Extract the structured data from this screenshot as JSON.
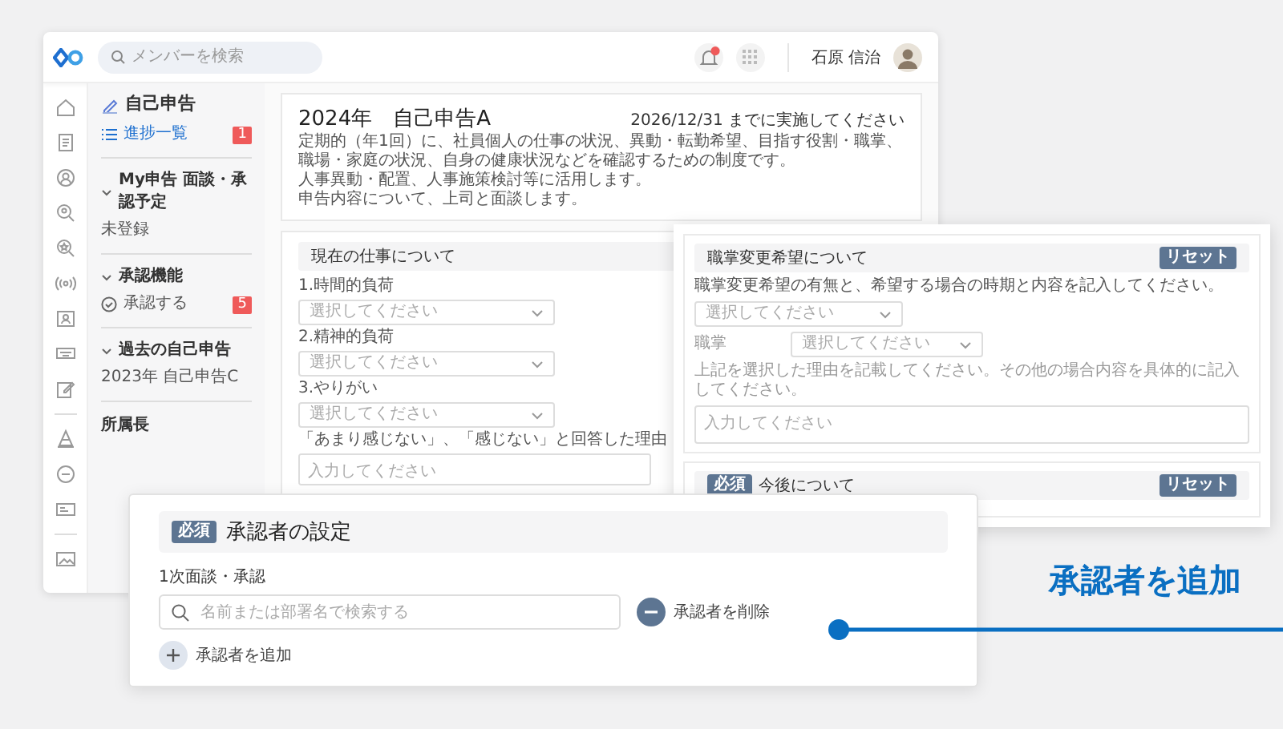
{
  "header": {
    "search": {
      "placeholder": "メンバーを検索"
    },
    "user_name": "石原 信治"
  },
  "sidebar": {
    "title": "自己申告",
    "link": {
      "label": "進捗一覧",
      "badge": "1",
      "selected": true
    },
    "sections": [
      {
        "heading": "My申告 面談・承認予定",
        "expanded": true,
        "items": [
          {
            "label": "未登録",
            "kind": "text"
          }
        ]
      },
      {
        "heading": "承認機能",
        "expanded": true,
        "items": [
          {
            "label": "承認する",
            "kind": "action",
            "badge": "5"
          }
        ]
      },
      {
        "heading": "過去の自己申告",
        "expanded": true,
        "items": [
          {
            "label": "2023年 自己申告C",
            "kind": "text"
          }
        ]
      }
    ],
    "footer": "所属長"
  },
  "survey": {
    "title": "2024年　自己申告A",
    "deadline": "2026/12/31 までに実施してください",
    "description": [
      "定期的（年1回）に、社員個人の仕事の状況、異動・転勤希望、目指す役割・職掌、職場・家庭の状況、自身の健康状況などを確認するための制度です。",
      "人事異動・配置、人事施策検討等に活用します。",
      "申告内容について、上司と面談します。"
    ]
  },
  "current_job": {
    "heading": "現在の仕事について",
    "questions": [
      {
        "label": "1.時間的負荷",
        "placeholder": "選択してください"
      },
      {
        "label": "2.精神的負荷",
        "placeholder": "選択してください"
      },
      {
        "label": "3.やりがい",
        "placeholder": "選択してください"
      }
    ],
    "reason_label": "「あまり感じない」、「感じない」と回答した理由",
    "reason_placeholder": "入力してください"
  },
  "career_change": {
    "heading": "職掌変更希望について",
    "reset": "リセット",
    "instruction": "職掌変更希望の有無と、希望する場合の時期と内容を記入してください。",
    "select_placeholder": "選択してください",
    "field_label": "職掌",
    "field_placeholder": "選択してください",
    "reason_label": "上記を選択した理由を記載してください。その他の場合内容を具体的に記入してください。",
    "reason_placeholder": "入力してください"
  },
  "future": {
    "required_badge": "必須",
    "heading": "今後について",
    "reset": "リセット"
  },
  "approver": {
    "required_badge": "必須",
    "heading": "承認者の設定",
    "step_label": "1次面談・承認",
    "search_placeholder": "名前または部署名で検索する",
    "remove_label": "承認者を削除",
    "add_label": "承認者を追加"
  },
  "callout": {
    "text": "承認者を追加"
  }
}
